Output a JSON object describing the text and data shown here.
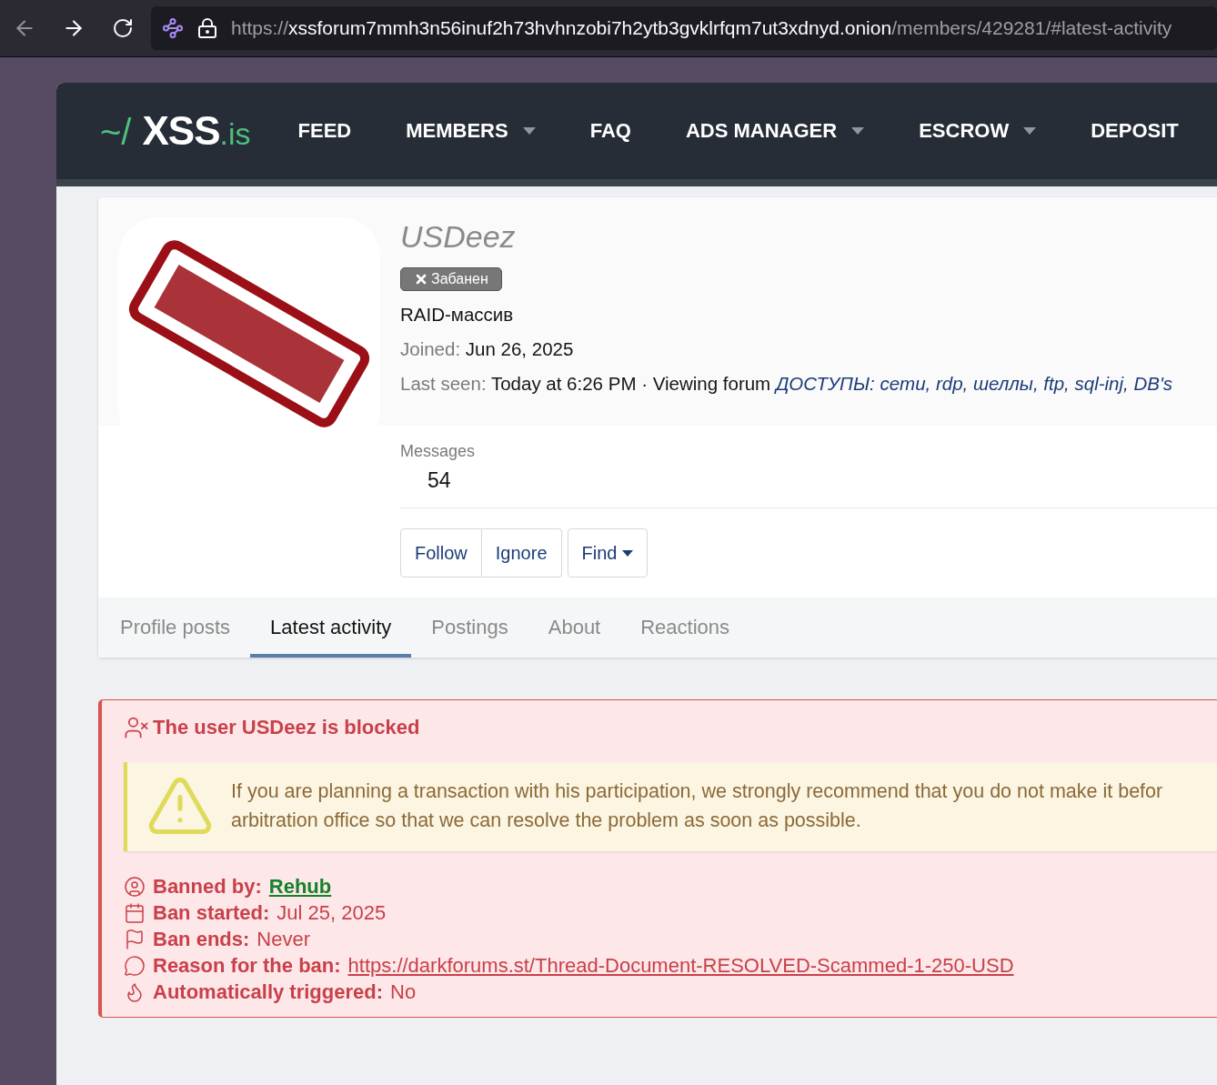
{
  "browser": {
    "url_scheme": "https://",
    "url_host": "xssforum7mmh3n56inuf2h73hvhnzobi7h2ytb3gvklrfqm7ut3xdnyd.onion",
    "url_path": "/members/429281/#latest-activity"
  },
  "nav": {
    "logo": {
      "prefix": "~/",
      "name": "XSS",
      "suffix": ".is"
    },
    "items": [
      {
        "label": "FEED",
        "dropdown": false
      },
      {
        "label": "MEMBERS",
        "dropdown": true
      },
      {
        "label": "FAQ",
        "dropdown": false
      },
      {
        "label": "ADS MANAGER",
        "dropdown": true
      },
      {
        "label": "ESCROW",
        "dropdown": true
      },
      {
        "label": "DEPOSIT",
        "dropdown": false
      }
    ]
  },
  "profile": {
    "username": "USDeez",
    "banner": "Забанен",
    "user_title": "RAID-массив",
    "joined": {
      "label": "Joined:",
      "value": "Jun 26, 2025"
    },
    "last_seen": {
      "label": "Last seen:",
      "value": "Today at 6:26 PM · Viewing forum",
      "forum": "ДОСТУПЫ: cemu, rdp, шеллы, ftp, sql-inj, DB's"
    },
    "stats": [
      {
        "label": "Messages",
        "value": "54"
      }
    ],
    "buttons": [
      {
        "label": "Follow",
        "joined_to_previous": false,
        "dropdown": false
      },
      {
        "label": "Ignore",
        "joined_to_previous": true,
        "dropdown": false
      },
      {
        "label": "Find",
        "joined_to_previous": false,
        "dropdown": true
      }
    ],
    "tabs": [
      {
        "label": "Profile posts",
        "selected": false
      },
      {
        "label": "Latest activity",
        "selected": true
      },
      {
        "label": "Postings",
        "selected": false
      },
      {
        "label": "About",
        "selected": false
      },
      {
        "label": "Reactions",
        "selected": false
      }
    ]
  },
  "ban_notice": {
    "title": "The user USDeez is blocked",
    "warning_lines": [
      "If you are planning a transaction with his participation, we strongly recommend that you do not make it befor",
      "arbitration office so that we can resolve the problem as soon as possible."
    ],
    "details": [
      {
        "kind": "banned-by",
        "label": "Banned by:",
        "value": "Rehub"
      },
      {
        "kind": "started",
        "label": "Ban started:",
        "value": "Jul 25, 2025"
      },
      {
        "kind": "ends",
        "label": "Ban ends:",
        "value": "Never"
      },
      {
        "kind": "reason",
        "label": "Reason for the ban:",
        "value": "https://darkforums.st/Thread-Document-RESOLVED-Scammed-1-250-USD"
      },
      {
        "kind": "auto",
        "label": "Automatically triggered:",
        "value": "No"
      }
    ]
  }
}
